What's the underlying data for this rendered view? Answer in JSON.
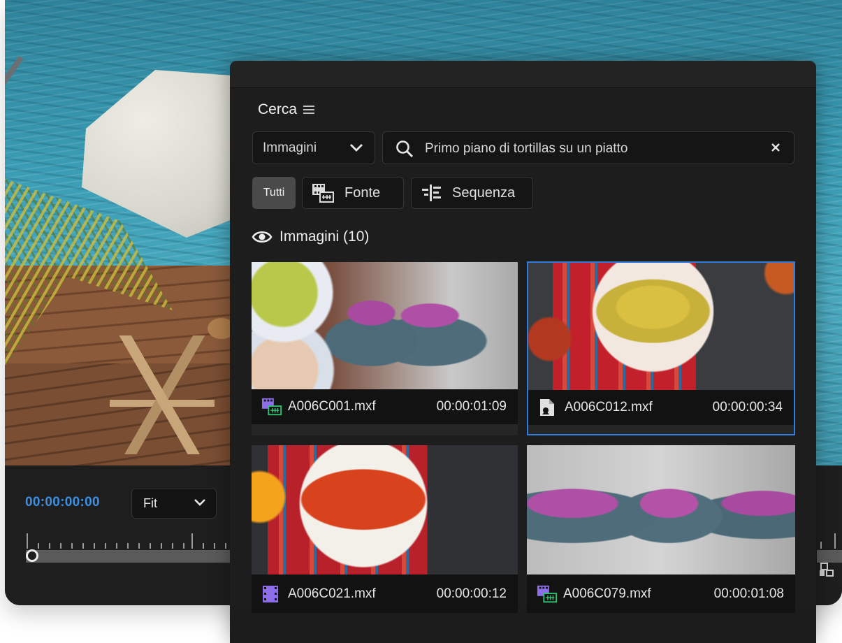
{
  "program": {
    "timecode": "00:00:00:00",
    "zoom_select": "Fit"
  },
  "panel": {
    "title": "Cerca",
    "type_filter": "Immagini",
    "search_query": "Primo piano di tortillas su un piatto",
    "filters": [
      {
        "label": "Tutti",
        "active": true
      },
      {
        "label": "Fonte",
        "icon": "source-clip-icon"
      },
      {
        "label": "Sequenza",
        "icon": "sequence-icon"
      }
    ],
    "results_header": "Immagini (10)",
    "results": [
      {
        "name": "A006C001.mxf",
        "duration": "00:00:01:09",
        "icon": "clip-video-audio-icon",
        "selected": false
      },
      {
        "name": "A006C012.mxf",
        "duration": "00:00:00:34",
        "icon": "image-file-icon",
        "selected": true
      },
      {
        "name": "A006C021.mxf",
        "duration": "00:00:00:12",
        "icon": "video-only-icon",
        "selected": false
      },
      {
        "name": "A006C079.mxf",
        "duration": "00:00:01:08",
        "icon": "clip-video-audio-icon",
        "selected": false
      }
    ]
  },
  "colors": {
    "accent": "#2f7be0",
    "timecode": "#3d8fe0",
    "clip_purple": "#8d6ee8",
    "audio_green": "#2fbf71"
  }
}
